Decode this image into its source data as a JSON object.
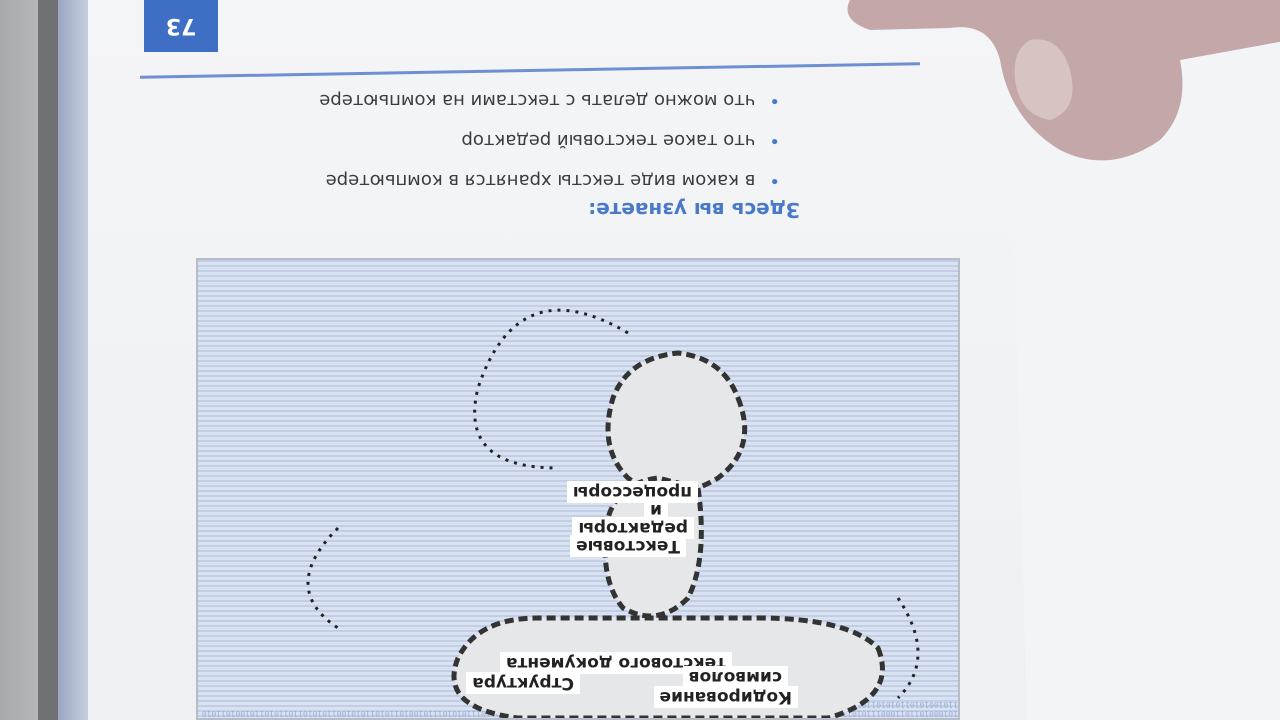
{
  "page": {
    "page_number": "73",
    "heading": "Здесь вы узнаете:",
    "bullets": [
      "в каком виде тексты хранятся в компьютере",
      "что такое текстовый редактор",
      "что можно делать с текстами на компьютере"
    ]
  },
  "figure": {
    "binary_text": "101000101101100011101011010111101010010010111000101101010110100101101011100101110101101011010010110111010101110100101101011010100110101011011010110100101101011010010101101010110101001101010110101101010010110101101",
    "labels": {
      "processors": "процессоры",
      "and": "и",
      "editors": "редакторы",
      "text": "Текстовые",
      "structure": "Структура",
      "doc": "текстового документа",
      "coding": "Кодирование",
      "symbols": "символов"
    }
  }
}
